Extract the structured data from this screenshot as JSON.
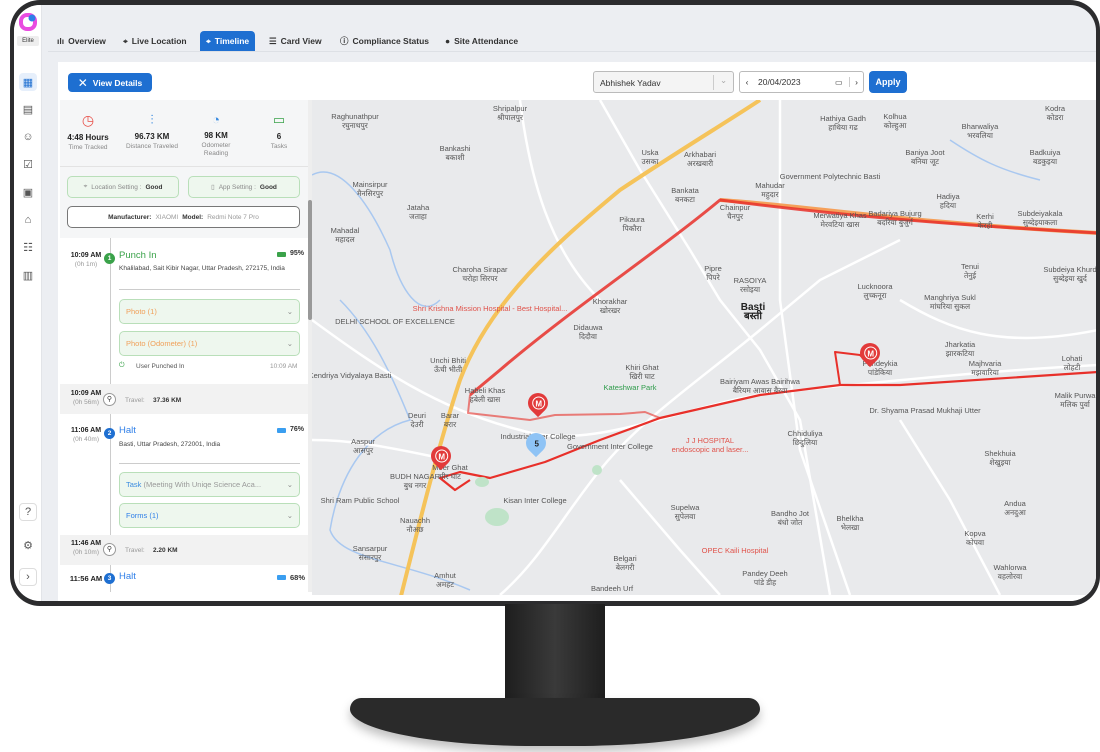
{
  "app": {
    "name": "Elite",
    "brand_color": "#1e6fd1"
  },
  "rail": {
    "icons": [
      "dashboard-icon",
      "calendar-icon",
      "user-icon",
      "checklist-icon",
      "report-icon",
      "bank-icon",
      "team-icon",
      "document-icon"
    ],
    "bottom_icons": [
      "help-icon",
      "settings-icon",
      "expand-icon"
    ]
  },
  "tabs": [
    {
      "label": "Overview",
      "icon": "bar-chart-icon"
    },
    {
      "label": "Live Location",
      "icon": "location-pin-icon"
    },
    {
      "label": "Timeline",
      "icon": "timeline-pin-icon",
      "active": true
    },
    {
      "label": "Card View",
      "icon": "card-icon"
    },
    {
      "label": "Compliance Status",
      "icon": "info-icon"
    },
    {
      "label": "Site Attendance",
      "icon": "site-pin-icon"
    }
  ],
  "toolbar": {
    "view_details": "View Details",
    "employee": "Abhishek Yadav",
    "date": "20/04/2023",
    "apply": "Apply"
  },
  "stats": [
    {
      "value": "4:48 Hours",
      "label": "Time Tracked",
      "color": "#e8514a"
    },
    {
      "value": "96.73 KM",
      "label": "Distance Traveled",
      "color": "#3a8be0"
    },
    {
      "value": "98 KM",
      "label": "Odometer Reading",
      "color": "#3a8be0"
    },
    {
      "value": "6",
      "label": "Tasks",
      "color": "#3aa24a"
    }
  ],
  "settings": {
    "location_label": "Location Setting :",
    "location_value": "Good",
    "app_label": "App Setting :",
    "app_value": "Good"
  },
  "device": {
    "manufacturer_label": "Manufacturer:",
    "manufacturer": "XIAOMI",
    "model_label": "Model:",
    "model": "Redmi Note 7 Pro"
  },
  "timeline": {
    "e1": {
      "time": "10:09 AM",
      "duration": "(0h 1m)",
      "num": "1",
      "title": "Punch In",
      "battery": "95%",
      "address": "Khalilabad, Sait Kibir Nagar, Uttar Pradesh, 272175, India",
      "acc1": "Photo (1)",
      "acc2": "Photo (Odometer) (1)",
      "status": "User Punched In",
      "status_time": "10:09 AM"
    },
    "t1": {
      "time": "10:09 AM",
      "duration": "(0h 56m)",
      "label": "Travel:",
      "value": "37.36 KM"
    },
    "e2": {
      "time": "11:06 AM",
      "duration": "(0h 40m)",
      "num": "2",
      "title": "Halt",
      "battery": "76%",
      "address": "Basti, Uttar Pradesh, 272001, India",
      "acc1_key": "Task",
      "acc1": "(Meeting With Uniqe Science Aca...",
      "acc2": "Forms (1)"
    },
    "t2": {
      "time": "11:46 AM",
      "duration": "(0h 10m)",
      "label": "Travel:",
      "value": "2.20 KM"
    },
    "e3": {
      "time": "11:56 AM",
      "num": "3",
      "title": "Halt",
      "battery": "68%"
    }
  },
  "map": {
    "markers": [
      {
        "label": "M"
      },
      {
        "label": "M"
      },
      {
        "label": "M"
      },
      {
        "label": "5"
      }
    ],
    "route_color": "#e8302a",
    "places": [
      [
        "Raghunathpur",
        "रघुनाथपुर"
      ],
      [
        "Shripalpur",
        "श्रीपालपुर"
      ],
      [
        "Bankashi",
        "बकाशी"
      ],
      [
        "Mainsirpur",
        "मैनसिरपुर"
      ],
      [
        "Jataha",
        "जताहा"
      ],
      [
        "Mahadal",
        "महादल"
      ],
      [
        "Uska",
        "उसका"
      ],
      [
        "Arkhabari",
        "अरखबारी"
      ],
      [
        "Bankata",
        "बनकटा"
      ],
      [
        "Pikaura",
        "पिकौरा"
      ],
      [
        "Chainpur",
        "चैनपुर"
      ],
      [
        "Mahudar",
        "महुदार"
      ],
      [
        "Government Polytechnic Basti",
        ""
      ],
      [
        "Hathiya Gadh",
        "हाथिया गढ"
      ],
      [
        "Kolhua",
        "कोल्हुआ"
      ],
      [
        "Kodra",
        "कोडरा"
      ],
      [
        "Bharwaliya",
        "भरवलिया"
      ],
      [
        "Baniya Joot",
        "बनिया जूट"
      ],
      [
        "Badkuiya",
        "बडकुइया"
      ],
      [
        "Hadiya",
        "हदिया"
      ],
      [
        "Kerhi",
        "केरही"
      ],
      [
        "Subdeiyakala",
        "सुब्देइयाकला"
      ],
      [
        "Merwatiya Khas",
        "मेरवटिया खास"
      ],
      [
        "Badariya Bujurg",
        "बदरिया बुजुर्ग"
      ],
      [
        "Charoha Sirapar",
        "चरोहा सिरपर"
      ],
      [
        "Pipre",
        "पिपरे"
      ],
      [
        "RASOIYA",
        "रसोइया"
      ],
      [
        "Basti",
        "बस्ती"
      ],
      [
        "Khorakhar",
        "खोरखर"
      ],
      [
        "Lucknoora",
        "लुच्कनूरा"
      ],
      [
        "Tenui",
        "तेनुई"
      ],
      [
        "Subdeiya Khurd",
        "सुब्देइया खुर्द"
      ],
      [
        "Manghriya Sukl",
        "मांघरिया सुकल"
      ],
      [
        "Didauwa",
        "दिदौवा"
      ],
      [
        "DELHI SCHOOL OF EXCELLENCE",
        ""
      ],
      [
        "Shri Krishna Mission Hospital - Best Hospital...",
        ""
      ],
      [
        "Unchi Bhiti",
        "ऊँची भीती"
      ],
      [
        "Khiri Ghat",
        "खिरी घाट"
      ],
      [
        "Kateshwar Park",
        ""
      ],
      [
        "Kendriya Vidyalaya Basti",
        ""
      ],
      [
        "Habeli Khas",
        "हबेली खास"
      ],
      [
        "Bairiyam Awas Bairihwa",
        "बैरियम आवास बैरवा"
      ],
      [
        "Jharkatia",
        "झारकटिया"
      ],
      [
        "Majhvaria",
        "मझवारिया"
      ],
      [
        "Lohati",
        "लोहटी"
      ],
      [
        "Deuri",
        "देउरी"
      ],
      [
        "Barar",
        "बरार"
      ],
      [
        "Aaspur",
        "आसपुर"
      ],
      [
        "Industrial Inter College",
        ""
      ],
      [
        "Government Inter College",
        ""
      ],
      [
        "J J HOSPITAL",
        "endoscopic and laser..."
      ],
      [
        "Chhiduliya",
        "छिदुलिया"
      ],
      [
        "Dr. Shyama Prasad Mukhaji Utter",
        ""
      ],
      [
        "Malik Purwa",
        "मलिक पुर्वा"
      ],
      [
        "BUDH NAGAR",
        "बुध नगर"
      ],
      [
        "Shri Ram Public School",
        ""
      ],
      [
        "Kisan Inter College",
        ""
      ],
      [
        "Nauachh",
        "नौअछ"
      ],
      [
        "Supelwa",
        "सुपेलवा"
      ],
      [
        "Bandho Jot",
        "बंधो जोत"
      ],
      [
        "Bhelkha",
        "भेलखा"
      ],
      [
        "Shekhuia",
        "शेखुइया"
      ],
      [
        "Andua",
        "अनदुआ"
      ],
      [
        "Kopva",
        "कोपवा"
      ],
      [
        "Wahlorwa",
        "वहलोरवा"
      ],
      [
        "Sansarpur",
        "संसारपुर"
      ],
      [
        "Amhut",
        "अमहट"
      ],
      [
        "Belgari",
        "बेलगरी"
      ],
      [
        "OPEC Kaili Hospital",
        ""
      ],
      [
        "Pandey Deeh",
        "पांडे डीह"
      ],
      [
        "Bandeeh Urf",
        ""
      ],
      [
        "Pandeykia",
        "पांडेकिया"
      ],
      [
        "Meer Ghat",
        "मीर घाट"
      ]
    ]
  }
}
